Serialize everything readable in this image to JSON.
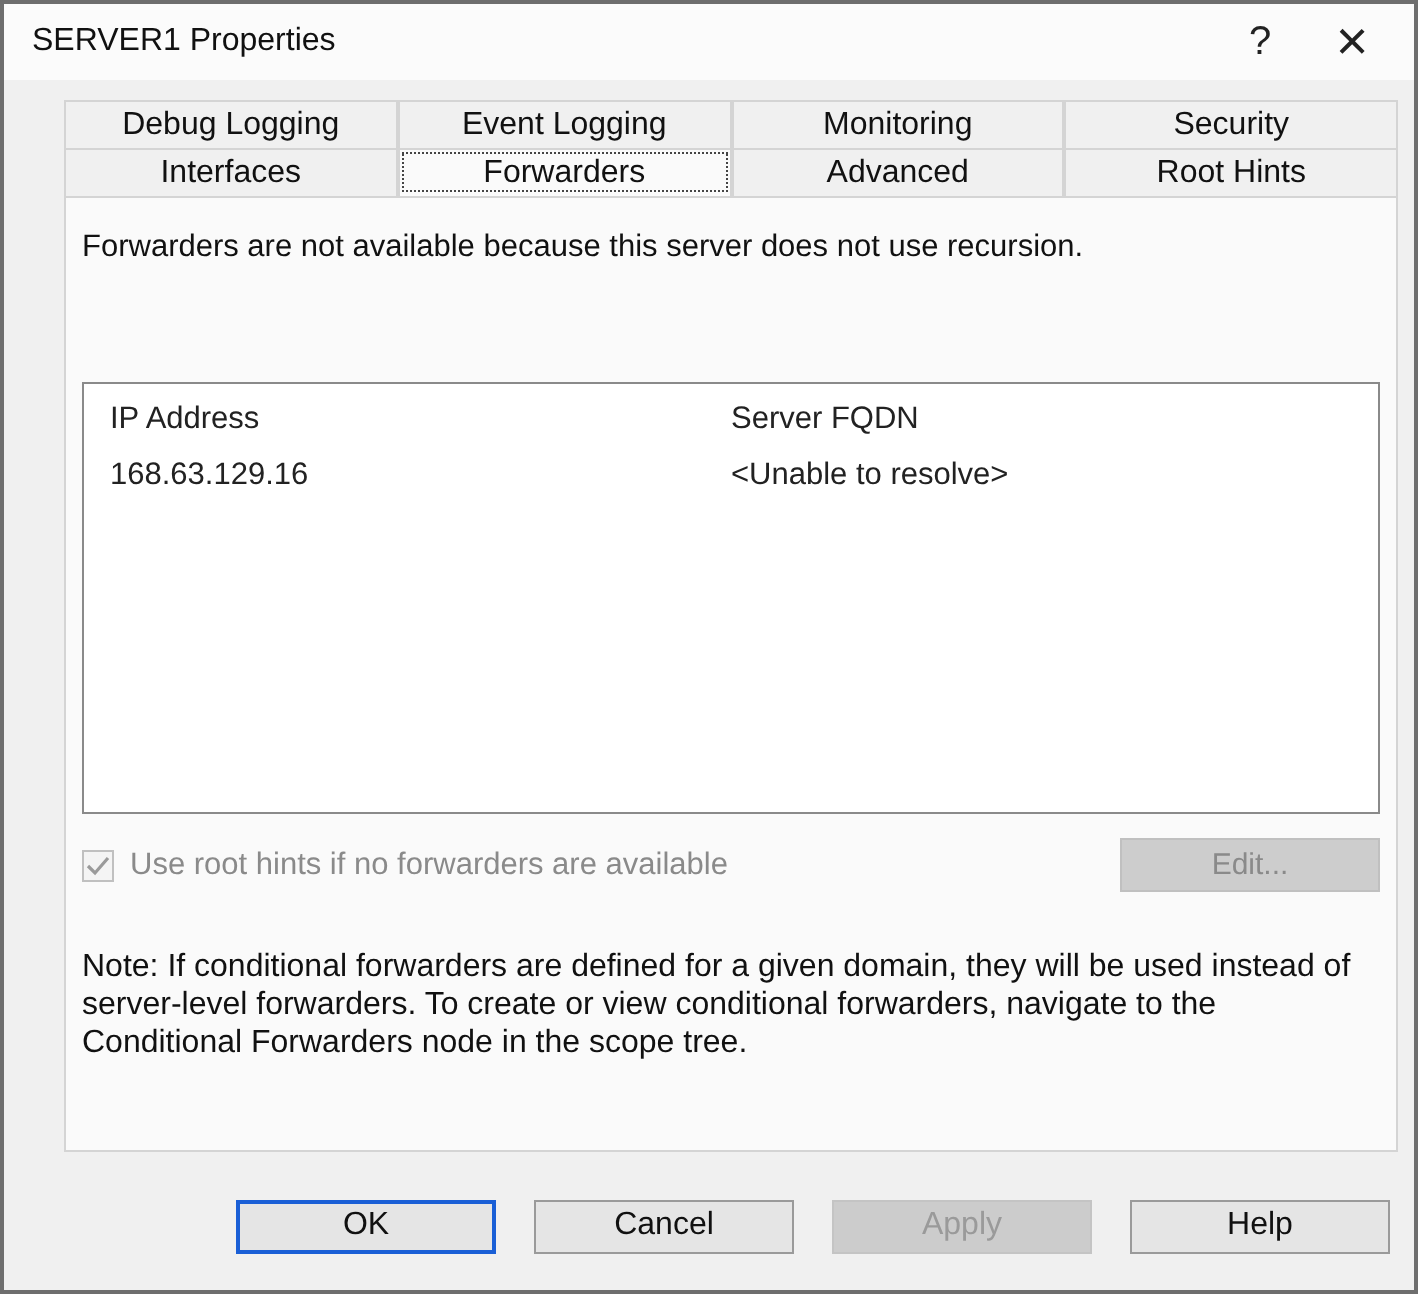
{
  "window": {
    "title": "SERVER1 Properties",
    "help_button": "?",
    "close_button": "×"
  },
  "tab_rows": [
    {
      "tabs": [
        {
          "label": "Debug Logging",
          "selected": false
        },
        {
          "label": "Event Logging",
          "selected": false
        },
        {
          "label": "Monitoring",
          "selected": false
        },
        {
          "label": "Security",
          "selected": false
        }
      ]
    },
    {
      "tabs": [
        {
          "label": "Interfaces",
          "selected": false
        },
        {
          "label": "Forwarders",
          "selected": true
        },
        {
          "label": "Advanced",
          "selected": false
        },
        {
          "label": "Root Hints",
          "selected": false
        }
      ]
    }
  ],
  "message": "Forwarders are not available because this server does not use recursion.",
  "table": {
    "columns": [
      "IP Address",
      "Server FQDN"
    ],
    "rows": [
      [
        "168.63.129.16",
        "<Unable to resolve>"
      ]
    ]
  },
  "root_hints_checkbox": {
    "label": "Use root hints if no forwarders are available",
    "checked": true,
    "disabled": true
  },
  "edit_button": {
    "label": "Edit...",
    "disabled": true
  },
  "note": "Note: If conditional forwarders are defined for a given domain, they will be used instead of server-level forwarders.  To create or view conditional forwarders, navigate to the Conditional Forwarders node in the scope tree.",
  "buttons": [
    {
      "label": "OK",
      "default": true,
      "disabled": false
    },
    {
      "label": "Cancel",
      "default": false,
      "disabled": false
    },
    {
      "label": "Apply",
      "default": false,
      "disabled": true
    },
    {
      "label": "Help",
      "default": false,
      "disabled": false
    }
  ]
}
